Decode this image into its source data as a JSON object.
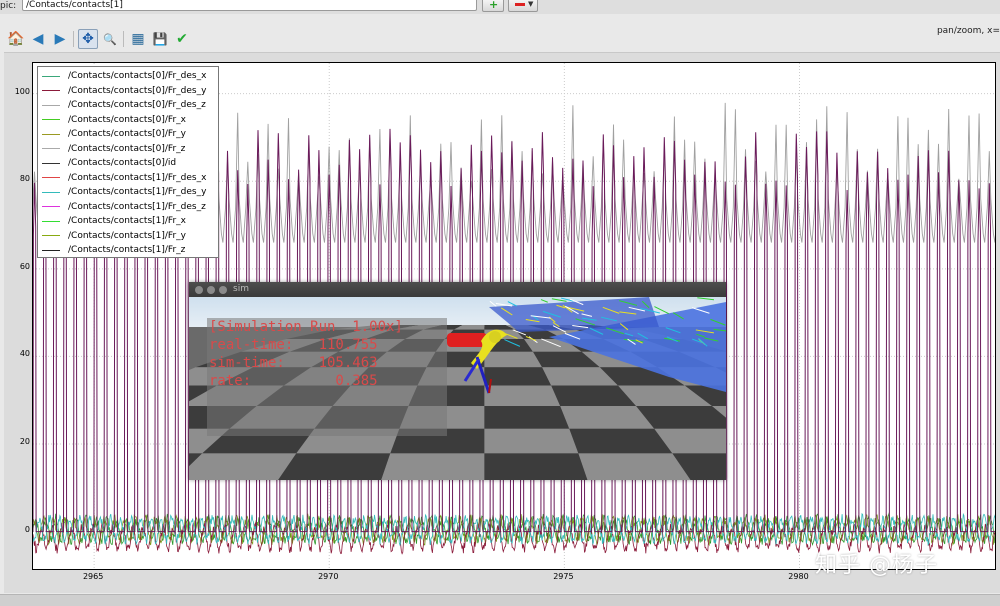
{
  "topic": {
    "label": "pic:",
    "value": "/Contacts/contacts[1]"
  },
  "toolbar": {
    "buttons": [
      {
        "icon": "home-icon",
        "glyph": "🏠"
      },
      {
        "icon": "back-icon",
        "glyph": "◀"
      },
      {
        "icon": "forward-icon",
        "glyph": "▶"
      },
      {
        "icon": "pan-icon",
        "glyph": "✥"
      },
      {
        "icon": "zoom-icon",
        "glyph": "🔍"
      },
      {
        "icon": "subplots-icon",
        "glyph": "▦"
      },
      {
        "icon": "save-icon",
        "glyph": "💾"
      },
      {
        "icon": "edit-check-icon",
        "glyph": "✔"
      }
    ],
    "status": "pan/zoom, x="
  },
  "chart_data": {
    "type": "line",
    "xlim": [
      2963.7,
      2984.2
    ],
    "ylim": [
      -9,
      107
    ],
    "xticks": [
      2965,
      2970,
      2975,
      2980
    ],
    "yticks": [
      0,
      20,
      40,
      60,
      80,
      100
    ],
    "grid": true,
    "legend_position": "top-left",
    "series": [
      {
        "name": "/Contacts/contacts[0]/Fr_des_x",
        "color": "#3aa77a"
      },
      {
        "name": "/Contacts/contacts[0]/Fr_des_y",
        "color": "#8b1a3a"
      },
      {
        "name": "/Contacts/contacts[0]/Fr_des_z",
        "color": "#a8a8a8"
      },
      {
        "name": "/Contacts/contacts[0]/Fr_x",
        "color": "#44cc22"
      },
      {
        "name": "/Contacts/contacts[0]/Fr_y",
        "color": "#9a9a22"
      },
      {
        "name": "/Contacts/contacts[0]/Fr_z",
        "color": "#aaaaaa"
      },
      {
        "name": "/Contacts/contacts[0]/id",
        "color": "#333333"
      },
      {
        "name": "/Contacts/contacts[1]/Fr_des_x",
        "color": "#e04545"
      },
      {
        "name": "/Contacts/contacts[1]/Fr_des_y",
        "color": "#33bbbb"
      },
      {
        "name": "/Contacts/contacts[1]/Fr_des_z",
        "color": "#dd33dd"
      },
      {
        "name": "/Contacts/contacts[1]/Fr_x",
        "color": "#33dd33"
      },
      {
        "name": "/Contacts/contacts[1]/Fr_y",
        "color": "#88aa11"
      },
      {
        "name": "/Contacts/contacts[1]/Fr_z",
        "color": "#222222"
      }
    ],
    "curves": {
      "period": 0.216,
      "spike_series_color": "#6a1a5a",
      "spike_low": 0,
      "spike_high_range": [
        78,
        92
      ],
      "grey_series_color": "#a0a0a0",
      "grey_base": 66,
      "grey_peak_range": [
        80,
        98
      ],
      "small_signal_colors": [
        "#2c9a2c",
        "#7a9a1a",
        "#8b1a3a",
        "#33bbbb"
      ],
      "small_signal_amplitude": 2.5
    }
  },
  "sim": {
    "title": "sim",
    "overlay": [
      "[Simulation Run  1.00x]",
      "real-time:   110.755",
      "sim-time:    105.463",
      "rate:          0.385"
    ]
  },
  "watermark": "知乎 @杨子"
}
